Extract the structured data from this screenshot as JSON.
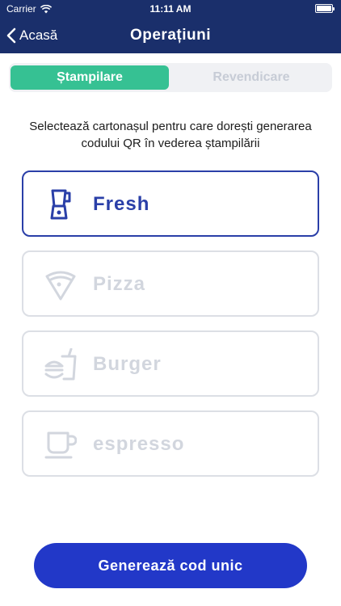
{
  "status_bar": {
    "carrier": "Carrier",
    "time": "11:11 AM"
  },
  "nav": {
    "back_label": "Acasă",
    "title": "Operațiuni"
  },
  "segments": [
    {
      "label": "Ștampilare",
      "selected": true
    },
    {
      "label": "Revendicare",
      "selected": false
    }
  ],
  "instruction": "Selectează cartonașul pentru care dorești generarea codului QR în vederea ștampilării",
  "cards": [
    {
      "label": "Fresh",
      "icon": "blender-icon",
      "selected": true
    },
    {
      "label": "Pizza",
      "icon": "pizza-slice-icon",
      "selected": false
    },
    {
      "label": "Burger",
      "icon": "burger-drink-icon",
      "selected": false
    },
    {
      "label": "espresso",
      "icon": "coffee-cup-icon",
      "selected": false
    }
  ],
  "primary_button": {
    "label": "Generează cod unic"
  },
  "colors": {
    "nav_bg": "#1a2f6b",
    "segment_active": "#36c193",
    "accent": "#2a3fa8",
    "button": "#2238c8",
    "inactive": "#d2d6de"
  }
}
